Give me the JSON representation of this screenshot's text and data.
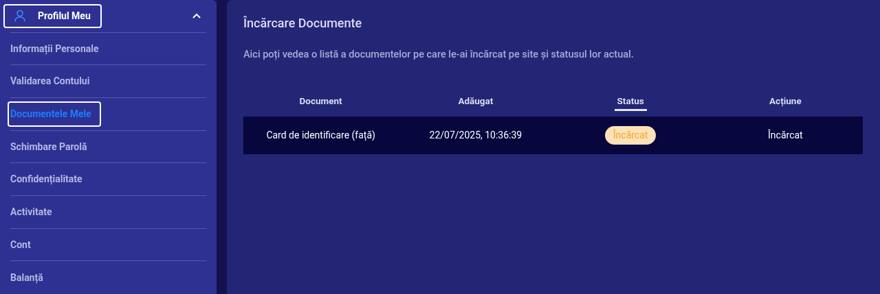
{
  "sidebar": {
    "header": {
      "label": "Profilul Meu",
      "expanded": true
    },
    "items": [
      {
        "label": "Informații Personale",
        "selected": false
      },
      {
        "label": "Validarea Contului",
        "selected": false
      },
      {
        "label": "Documentele Mele",
        "selected": true
      },
      {
        "label": "Schimbare Parolă",
        "selected": false
      },
      {
        "label": "Confidențialitate",
        "selected": false
      },
      {
        "label": "Activitate",
        "selected": false
      },
      {
        "label": "Cont",
        "selected": false
      },
      {
        "label": "Balanță",
        "selected": false
      }
    ]
  },
  "main": {
    "title": "Încărcare Documente",
    "description": "Aici poți vedea o listă a documentelor pe care le-ai încărcat pe site și statusul lor actual.",
    "table": {
      "columns": [
        {
          "label": "Document",
          "sorted": false
        },
        {
          "label": "Adăugat",
          "sorted": false
        },
        {
          "label": "Status",
          "sorted": true
        },
        {
          "label": "Acțiune",
          "sorted": false
        }
      ],
      "rows": [
        {
          "document": "Card de identificare (față)",
          "added": "22/07/2025, 10:36:39",
          "status": "Încărcat",
          "action": "Încărcat"
        }
      ]
    }
  }
}
